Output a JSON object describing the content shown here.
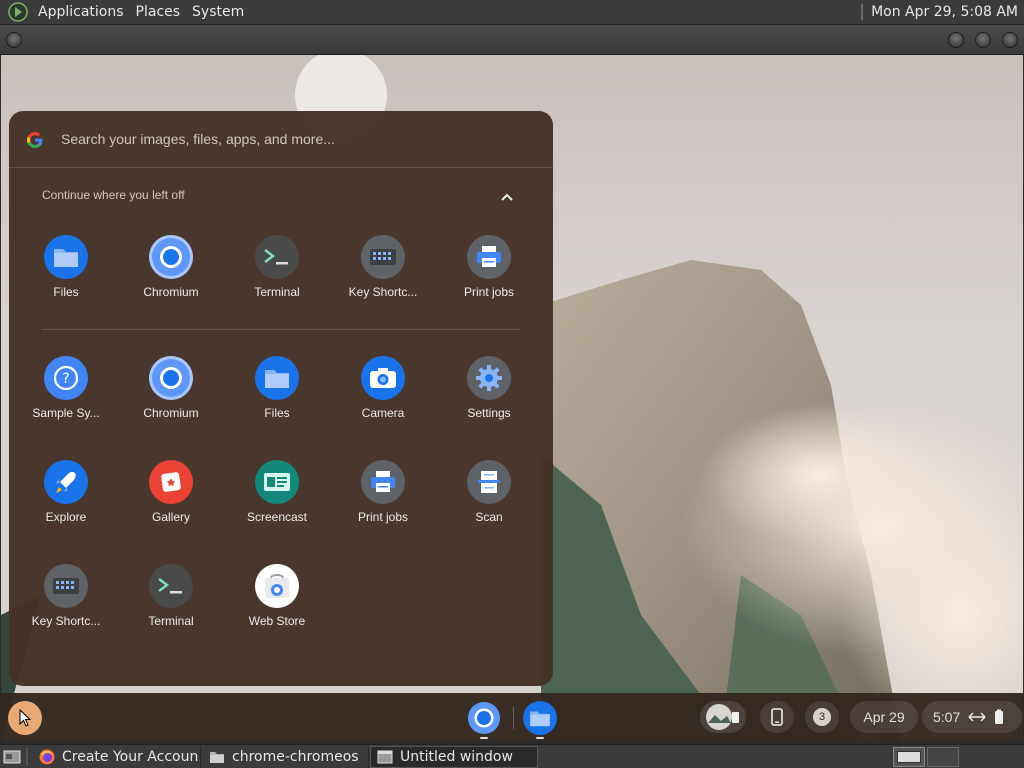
{
  "top_panel": {
    "menus": [
      "Applications",
      "Places",
      "System"
    ],
    "clock": "Mon Apr 29, 5:08 AM"
  },
  "launcher": {
    "search_placeholder": "Search your images, files, apps, and more...",
    "continue_label": "Continue where you left off",
    "recent_apps": [
      {
        "label": "Files",
        "icon": "files-icon"
      },
      {
        "label": "Chromium",
        "icon": "chromium-icon"
      },
      {
        "label": "Terminal",
        "icon": "terminal-icon"
      },
      {
        "label": "Key Shortc...",
        "icon": "keyboard-icon"
      },
      {
        "label": "Print jobs",
        "icon": "printer-icon"
      }
    ],
    "apps": [
      {
        "label": "Sample Sy...",
        "icon": "help-icon"
      },
      {
        "label": "Chromium",
        "icon": "chromium-icon"
      },
      {
        "label": "Files",
        "icon": "files-icon"
      },
      {
        "label": "Camera",
        "icon": "camera-icon"
      },
      {
        "label": "Settings",
        "icon": "gear-icon"
      },
      {
        "label": "Explore",
        "icon": "rocket-icon"
      },
      {
        "label": "Gallery",
        "icon": "gallery-icon"
      },
      {
        "label": "Screencast",
        "icon": "screencast-icon"
      },
      {
        "label": "Print jobs",
        "icon": "printer-icon"
      },
      {
        "label": "Scan",
        "icon": "scanner-icon"
      },
      {
        "label": "Key Shortc...",
        "icon": "keyboard-icon"
      },
      {
        "label": "Terminal",
        "icon": "terminal-icon"
      },
      {
        "label": "Web Store",
        "icon": "webstore-icon"
      }
    ]
  },
  "shelf": {
    "notification_count": "3",
    "date": "Apr 29",
    "time": "5:07"
  },
  "taskbar": {
    "tasks": [
      {
        "label": "Create Your Accoun...",
        "icon": "firefox-icon"
      },
      {
        "label": "chrome-chromeos",
        "icon": "folder-icon"
      },
      {
        "label": "Untitled window",
        "icon": "window-icon"
      }
    ]
  },
  "colors": {
    "launcher_bg": "#44322a",
    "shelf_bg": "#342820",
    "launcher_button": "#e9a974",
    "panel_bg": "#3b3b3b"
  }
}
